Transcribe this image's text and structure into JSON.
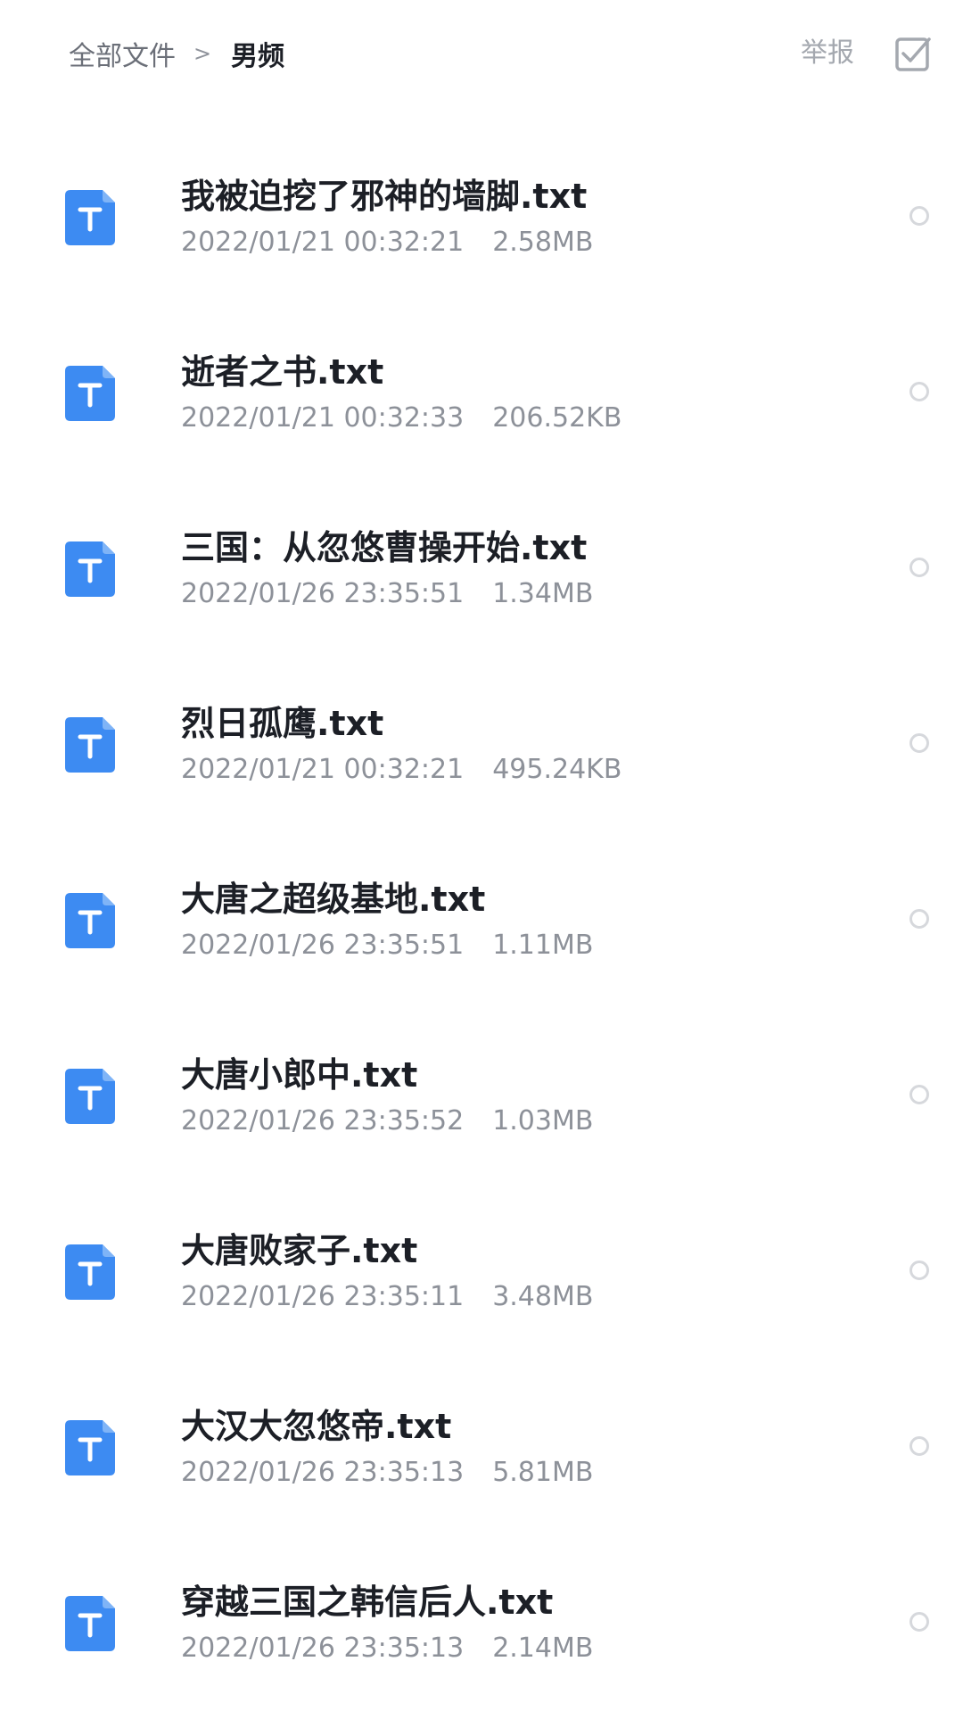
{
  "header": {
    "breadcrumb_root": "全部文件",
    "breadcrumb_separator": ">",
    "breadcrumb_current": "男频",
    "report_label": "举报",
    "select_icon": "checkbox-select-icon"
  },
  "files": [
    {
      "name": "我被迫挖了邪神的墙脚.txt",
      "date": "2022/01/21 00:32:21",
      "size": "2.58MB",
      "icon": "txt-file-icon"
    },
    {
      "name": "逝者之书.txt",
      "date": "2022/01/21 00:32:33",
      "size": "206.52KB",
      "icon": "txt-file-icon"
    },
    {
      "name": "三国：从忽悠曹操开始.txt",
      "date": "2022/01/26 23:35:51",
      "size": "1.34MB",
      "icon": "txt-file-icon"
    },
    {
      "name": "烈日孤鹰.txt",
      "date": "2022/01/21 00:32:21",
      "size": "495.24KB",
      "icon": "txt-file-icon"
    },
    {
      "name": "大唐之超级基地.txt",
      "date": "2022/01/26 23:35:51",
      "size": "1.11MB",
      "icon": "txt-file-icon"
    },
    {
      "name": "大唐小郎中.txt",
      "date": "2022/01/26 23:35:52",
      "size": "1.03MB",
      "icon": "txt-file-icon"
    },
    {
      "name": "大唐败家子.txt",
      "date": "2022/01/26 23:35:11",
      "size": "3.48MB",
      "icon": "txt-file-icon"
    },
    {
      "name": "大汉大忽悠帝.txt",
      "date": "2022/01/26 23:35:13",
      "size": "5.81MB",
      "icon": "txt-file-icon"
    },
    {
      "name": "穿越三国之韩信后人.txt",
      "date": "2022/01/26 23:35:13",
      "size": "2.14MB",
      "icon": "txt-file-icon"
    }
  ],
  "colors": {
    "file_icon_blue": "#3d8bf2",
    "title_text": "#1c1f26",
    "meta_text": "#8d9199",
    "radio_border": "#d6d8dc"
  }
}
